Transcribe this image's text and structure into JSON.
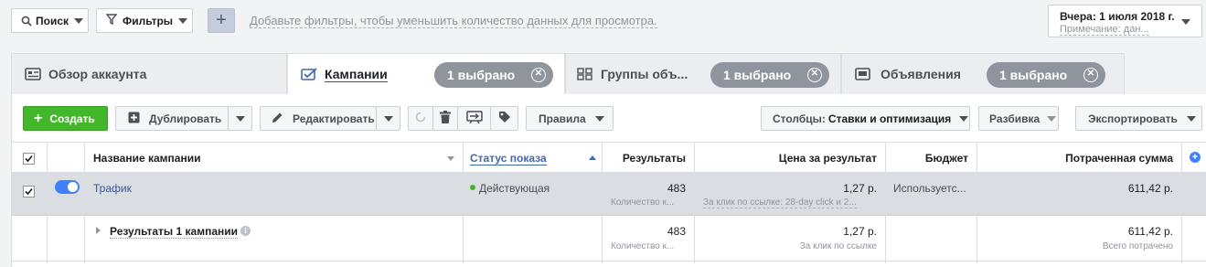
{
  "topbar": {
    "search_label": "Поиск",
    "filters_label": "Фильтры",
    "add_filter_hint": "Добавьте фильтры, чтобы уменьшить количество данных для просмотра.",
    "date_label": "Вчера: 1 июля 2018 г.",
    "date_note": "Примечание: дан..."
  },
  "tabs": [
    {
      "label": "Обзор аккаунта",
      "icon": "account-overview-icon"
    },
    {
      "label": "Кампании",
      "icon": "campaign-icon",
      "pill": "1 выбрано"
    },
    {
      "label": "Группы объ...",
      "icon": "adsets-icon",
      "pill": "1 выбрано"
    },
    {
      "label": "Объявления",
      "icon": "ads-icon",
      "pill": "1 выбрано"
    }
  ],
  "toolbar": {
    "create_label": "Создать",
    "duplicate_label": "Дублировать",
    "edit_label": "Редактировать",
    "rules_label": "Правила",
    "columns_prefix": "Столбцы:",
    "columns_value": "Ставки и оптимизация",
    "breakdown_label": "Разбивка",
    "export_label": "Экспортировать"
  },
  "columns": {
    "name": "Название кампании",
    "status": "Статус показа",
    "results": "Результаты",
    "cost": "Цена за результат",
    "budget": "Бюджет",
    "spent": "Потраченная сумма"
  },
  "rows": [
    {
      "name": "Трафик",
      "status": "Действующая",
      "results": "483",
      "results_sub": "Количество к...",
      "cost": "1,27 р.",
      "cost_sub": "За клик по ссылке: 28-day click и 2...",
      "budget": "Используетс...",
      "spent": "611,42 р."
    }
  ],
  "summary": {
    "label": "Результаты 1 кампании",
    "results": "483",
    "results_sub": "Количество к...",
    "cost": "1,27 р.",
    "cost_sub": "За клик по ссылке",
    "spent": "611,42 р.",
    "spent_sub": "Всего потрачено"
  },
  "colors": {
    "create_green": "#42b72a",
    "link_blue": "#365899",
    "active_dot": "#42b72a",
    "toggle_blue": "#4080ff",
    "selected_row": "#dadde1"
  }
}
